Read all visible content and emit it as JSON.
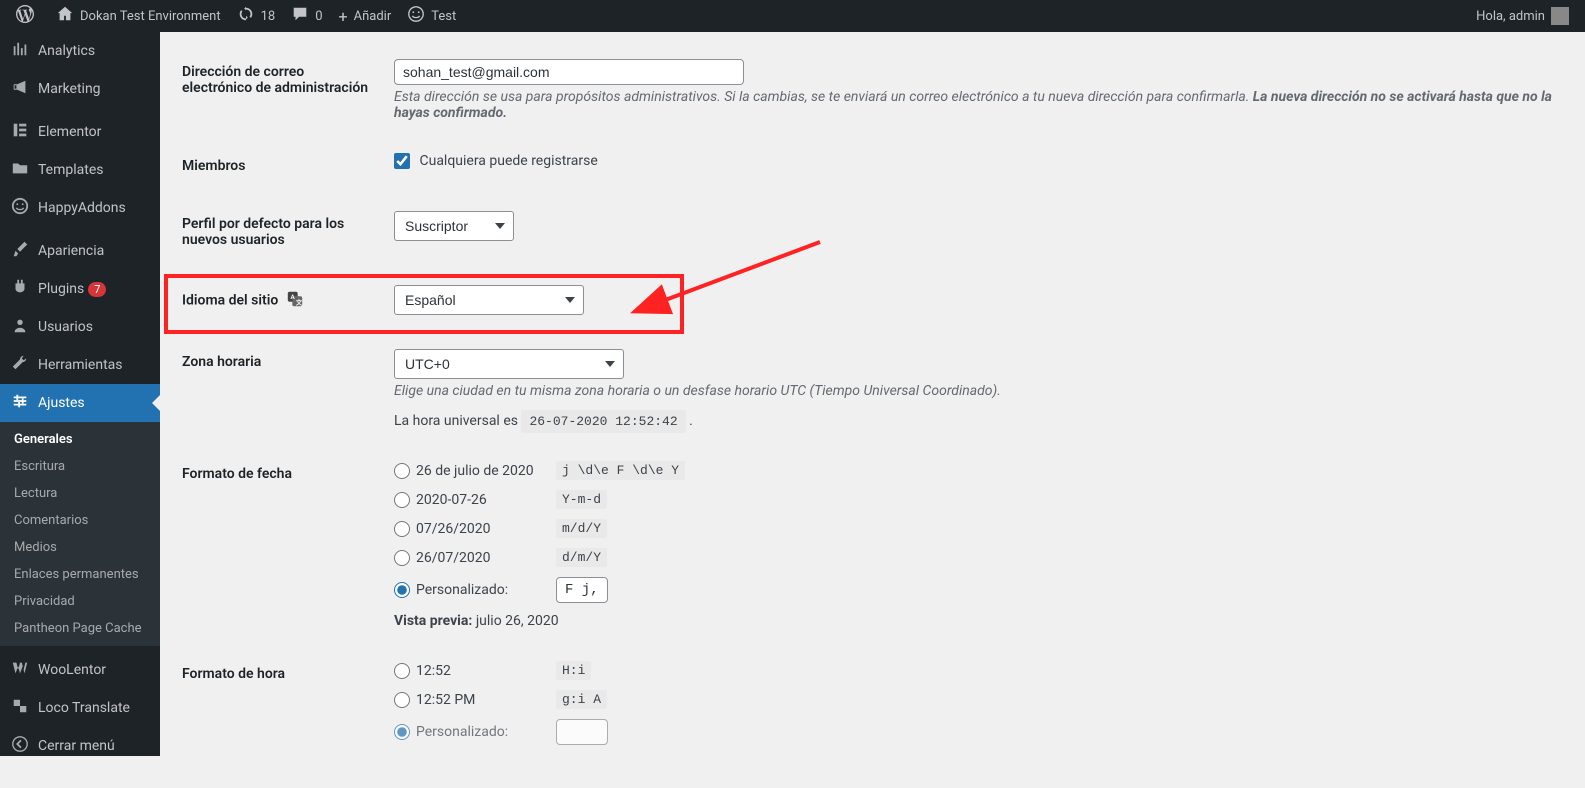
{
  "adminbar": {
    "site_name": "Dokan Test Environment",
    "updates_count": "18",
    "comments_count": "0",
    "add_new": "Añadir",
    "test_label": "Test",
    "greeting": "Hola, admin"
  },
  "sidebar": {
    "items": [
      {
        "label": "Analytics",
        "icon": "chart"
      },
      {
        "label": "Marketing",
        "icon": "megaphone"
      },
      {
        "label": "Elementor",
        "icon": "elementor"
      },
      {
        "label": "Templates",
        "icon": "folder"
      },
      {
        "label": "HappyAddons",
        "icon": "happy"
      },
      {
        "label": "Apariencia",
        "icon": "brush"
      },
      {
        "label": "Plugins",
        "icon": "plug",
        "badge": "7"
      },
      {
        "label": "Usuarios",
        "icon": "users"
      },
      {
        "label": "Herramientas",
        "icon": "wrench"
      },
      {
        "label": "Ajustes",
        "icon": "settings",
        "current": true
      },
      {
        "label": "WooLentor",
        "icon": "woolentor"
      },
      {
        "label": "Loco Translate",
        "icon": "translate"
      },
      {
        "label": "Cerrar menú",
        "icon": "collapse"
      }
    ],
    "submenu": [
      {
        "label": "Generales",
        "current": true
      },
      {
        "label": "Escritura"
      },
      {
        "label": "Lectura"
      },
      {
        "label": "Comentarios"
      },
      {
        "label": "Medios"
      },
      {
        "label": "Enlaces permanentes"
      },
      {
        "label": "Privacidad"
      },
      {
        "label": "Pantheon Page Cache"
      }
    ]
  },
  "settings": {
    "admin_email": {
      "label": "Dirección de correo electrónico de administración",
      "value": "sohan_test@gmail.com",
      "help1": "Esta dirección se usa para propósitos administrativos. Si la cambias, se te enviará un correo electrónico a tu nueva dirección para confirmarla. ",
      "help2": "La nueva dirección no se activará hasta que no la hayas confirmado."
    },
    "membership": {
      "label": "Miembros",
      "checkbox_label": "Cualquiera puede registrarse",
      "checked": true
    },
    "default_role": {
      "label": "Perfil por defecto para los nuevos usuarios",
      "value": "Suscriptor"
    },
    "site_language": {
      "label": "Idioma del sitio",
      "value": "Español"
    },
    "timezone": {
      "label": "Zona horaria",
      "value": "UTC+0",
      "help": "Elige una ciudad en tu misma zona horaria o un desfase horario UTC (Tiempo Universal Coordinado).",
      "universal_prefix": "La hora universal es ",
      "universal_value": "26-07-2020 12:52:42",
      "universal_suffix": " ."
    },
    "date_format": {
      "label": "Formato de fecha",
      "options": [
        {
          "display": "26 de julio de 2020",
          "code": "j \\d\\e F \\d\\e Y"
        },
        {
          "display": "2020-07-26",
          "code": "Y-m-d"
        },
        {
          "display": "07/26/2020",
          "code": "m/d/Y"
        },
        {
          "display": "26/07/2020",
          "code": "d/m/Y"
        }
      ],
      "custom_label": "Personalizado:",
      "custom_value": "F j, Y",
      "preview_label": "Vista previa:",
      "preview_value": "julio 26, 2020"
    },
    "time_format": {
      "label": "Formato de hora",
      "options": [
        {
          "display": "12:52",
          "code": "H:i"
        },
        {
          "display": "12:52 PM",
          "code": "g:i A"
        }
      ],
      "custom_label": "Personalizado:",
      "custom_value": ""
    }
  }
}
